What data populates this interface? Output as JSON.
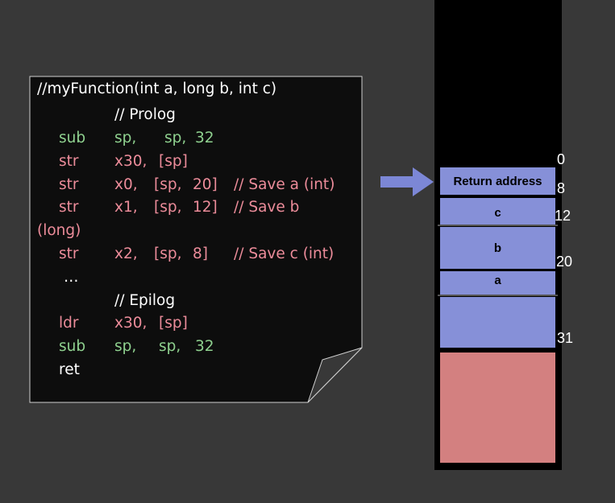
{
  "colors": {
    "keyword_green": "#8fd18f",
    "keyword_pink": "#ec8c9a",
    "plain_green": "#8fd18f",
    "operand": "#ec8c9a",
    "comment": "#ffffff",
    "slot_fill": "#8690d8",
    "heap_fill": "#d38080",
    "arrow_fill": "#7c87d6"
  },
  "code": {
    "header": "//myFunction(int a, long b, int c)",
    "prolog_comment": "//  Prolog",
    "line1": {
      "op": "sub",
      "a1": "sp,",
      "a2": "sp,",
      "a3": "32"
    },
    "line2": {
      "op": "str",
      "a1": "x30,",
      "a2": "[sp]"
    },
    "line3": {
      "op": "str",
      "a1": "x0,",
      "a2": "[sp,",
      "a3": "20]",
      "comment": "// Save a (int)"
    },
    "line4": {
      "op": "str",
      "a1": "x1,",
      "a2": "[sp,",
      "a3": "12]",
      "comment": "// Save b"
    },
    "line4_wrap": "(long)",
    "line5": {
      "op": "str",
      "a1": "x2,",
      "a2": "[sp,",
      "a3": "8]",
      "comment": "// Save c (int)"
    },
    "ellipsis": "…",
    "epilog_comment": "// Epilog",
    "line6": {
      "op": "ldr",
      "a1": "x30,",
      "a2": "[sp]"
    },
    "line7": {
      "op": "sub",
      "a1": "sp,",
      "a2": "sp,",
      "a3": "32"
    },
    "line8": {
      "op": "ret"
    }
  },
  "stack": {
    "slots": [
      {
        "label": "Return address"
      },
      {
        "label": "c"
      },
      {
        "label": "b"
      },
      {
        "label": "a"
      }
    ],
    "offsets": [
      "0",
      "8",
      "12",
      "20",
      "31"
    ]
  }
}
